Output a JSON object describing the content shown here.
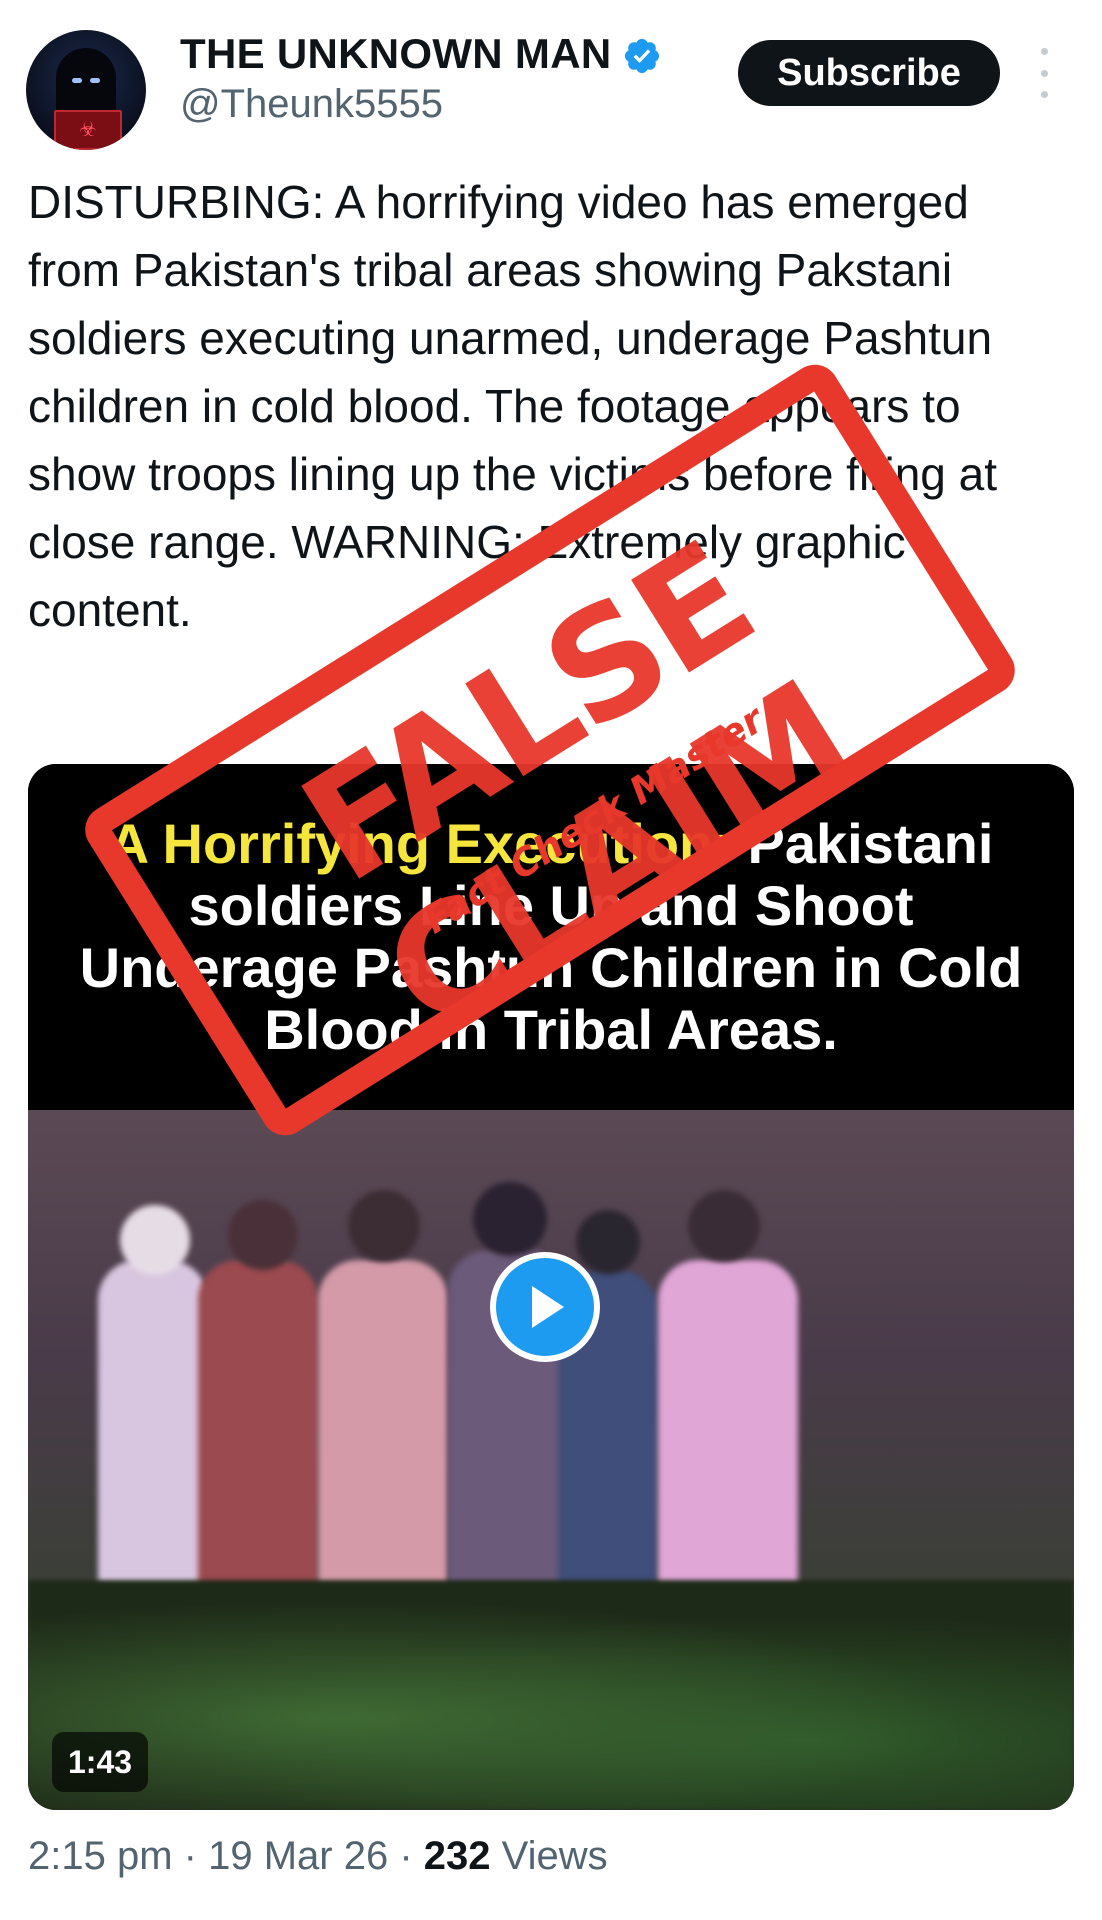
{
  "author": {
    "name": "THE UNKNOWN MAN",
    "handle": "@Theunk5555",
    "verified": true
  },
  "actions": {
    "subscribe_label": "Subscribe"
  },
  "tweet": {
    "text": "DISTURBING: A horrifying video has emerged from Pakistan's tribal areas showing Pakstani soldiers executing unarmed, underage Pashtun children in cold blood. The footage appears to show troops lining up the victims before firing at close range. WARNING: Extremely graphic content."
  },
  "media": {
    "caption_highlight": "A Horrifying Execution:",
    "caption_rest": " Pakistani soldiers Line Up and Shoot Underage Pashtun Children in Cold Blood in Tribal Areas.",
    "duration": "1:43"
  },
  "stamp": {
    "main_text": "FALSE CLAIM",
    "sub_text": "Fact Check Master",
    "color": "#e8372b"
  },
  "meta": {
    "time": "2:15 pm",
    "separator": "·",
    "date": "19 Mar 26",
    "views_count": "232",
    "views_label": "Views"
  },
  "colors": {
    "accent": "#1d9bf0",
    "text_primary": "#0f1419",
    "text_secondary": "#536471"
  },
  "icons": {
    "verified": "verified-badge-icon",
    "more": "more-vertical-icon",
    "play": "play-icon"
  }
}
